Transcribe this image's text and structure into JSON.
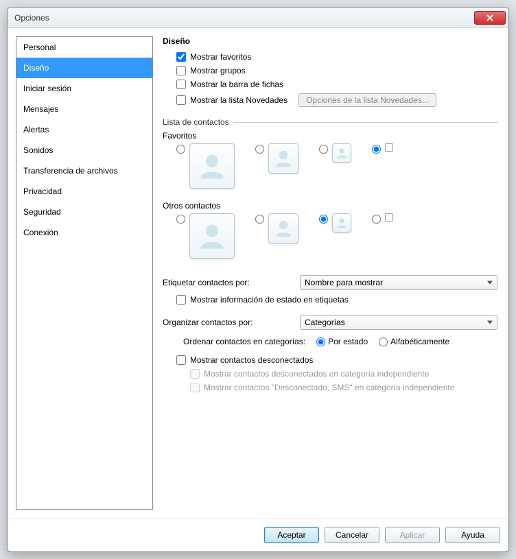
{
  "window": {
    "title": "Opciones"
  },
  "sidebar": {
    "items": [
      {
        "label": "Personal"
      },
      {
        "label": "Diseño"
      },
      {
        "label": "Iniciar sesión"
      },
      {
        "label": "Mensajes"
      },
      {
        "label": "Alertas"
      },
      {
        "label": "Sonidos"
      },
      {
        "label": "Transferencia de archivos"
      },
      {
        "label": "Privacidad"
      },
      {
        "label": "Seguridad"
      },
      {
        "label": "Conexión"
      }
    ],
    "selected_index": 1
  },
  "panel": {
    "heading": "Diseño",
    "checks": {
      "favorites": {
        "label": "Mostrar favoritos",
        "checked": true
      },
      "groups": {
        "label": "Mostrar grupos",
        "checked": false
      },
      "tabbar": {
        "label": "Mostrar la barra de fichas",
        "checked": false
      },
      "news": {
        "label": "Mostrar la lista Novedades",
        "checked": false
      }
    },
    "news_button": "Opciones de la lista Novedades...",
    "contact_list_label": "Lista de contactos",
    "favorites_label": "Favoritos",
    "favorites_selected": 3,
    "others_label": "Otros contactos",
    "others_selected": 2,
    "tag_by_label": "Etiquetar contactos por:",
    "tag_by_value": "Nombre para mostrar",
    "show_status_info": {
      "label": "Mostrar información de estado en etiquetas",
      "checked": false
    },
    "organize_by_label": "Organizar contactos por:",
    "organize_by_value": "Categorías",
    "sort_label": "Ordenar contactos en categorías:",
    "sort_options": {
      "by_status": "Por estado",
      "alpha": "Alfabéticamente"
    },
    "sort_selected": "by_status",
    "show_offline": {
      "label": "Mostrar contactos desconectados",
      "checked": false
    },
    "offline_separate": {
      "label": "Mostrar contactos desconectados en categoría independiente",
      "checked": false
    },
    "offline_sms_separate": {
      "label": "Mostrar contactos \"Desconectado, SMS\" en categoría independiente",
      "checked": false
    }
  },
  "footer": {
    "accept": "Aceptar",
    "cancel": "Cancelar",
    "apply": "Aplicar",
    "help": "Ayuda"
  }
}
